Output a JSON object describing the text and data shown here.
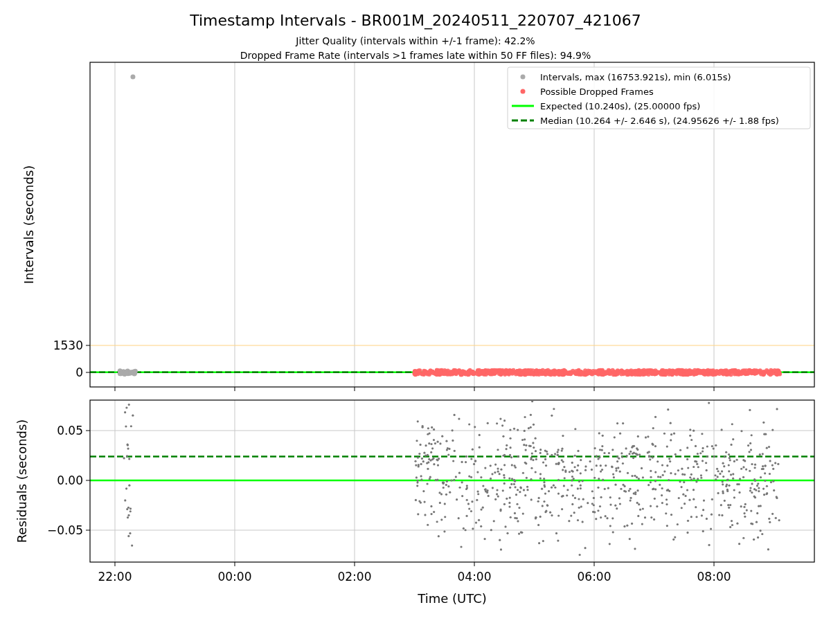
{
  "figure": {
    "title": "Timestamp Intervals - BR001M_20240511_220707_421067",
    "subtitles": [
      "Jitter Quality (intervals within +/-1 frame): 42.2%",
      "Dropped Frame Rate (intervals >1 frames late within 50 FF files): 94.9%"
    ],
    "xlabel": "Time (UTC)",
    "legend": [
      {
        "kind": "marker",
        "color": "#aaaaaa",
        "label": "Intervals, max (16753.921s), min (6.015s)"
      },
      {
        "kind": "marker",
        "color": "#ff6666",
        "label": "Possible Dropped Frames"
      },
      {
        "kind": "line",
        "color": "#00ff00",
        "label": "Expected (10.240s), (25.00000 fps)"
      },
      {
        "kind": "dashed",
        "color": "#008000",
        "label": "Median (10.264 +/- 2.646 s), (24.95626 +/- 1.88 fps)"
      }
    ]
  },
  "charts": [
    {
      "chart_data": {
        "type": "line",
        "ylabel": "Intervals (seconds)",
        "ylim": [
          -824,
          17575
        ],
        "grid": true,
        "categories": [
          null,
          null,
          null,
          null,
          null,
          null
        ],
        "yticks": [
          {
            "value": 0,
            "label": "0"
          },
          {
            "value": 1530,
            "label": "1530"
          }
        ],
        "ref_lines": [
          {
            "axis": "y",
            "value": 1530,
            "color": "#ffd280",
            "line_style": "solid"
          },
          {
            "axis": "y",
            "value": 10.2,
            "color": "#00ff00",
            "line_style": "solid"
          },
          {
            "axis": "y",
            "value": 10.3,
            "color": "#008000",
            "line_style": "dashed"
          }
        ]
      }
    },
    {
      "chart_data": {
        "type": "line",
        "ylabel": "Residuals (seconds)",
        "ylim": [
          -0.082,
          0.0806
        ],
        "grid": true,
        "categories": [
          "22:00",
          "00:00",
          "02:00",
          "04:00",
          "06:00",
          "08:00"
        ],
        "yticks": [
          {
            "value": -0.05,
            "label": "−0.05"
          },
          {
            "value": 0,
            "label": "0.00"
          },
          {
            "value": 0.05,
            "label": "0.05"
          }
        ],
        "ref_lines": [
          {
            "axis": "y",
            "value": 0,
            "color": "#00ff00",
            "line_style": "solid"
          },
          {
            "axis": "y",
            "value": 0.024,
            "color": "#008000",
            "line_style": "dashed"
          }
        ]
      }
    }
  ]
}
